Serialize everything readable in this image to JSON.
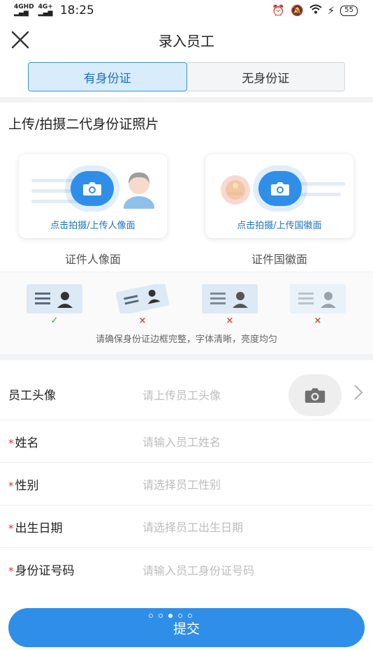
{
  "status_bar": {
    "signal_1": "4GHD",
    "signal_2": "4G+",
    "time": "18:25",
    "battery": "55"
  },
  "header": {
    "title": "录入员工"
  },
  "tabs": [
    {
      "label": "有身份证",
      "active": true
    },
    {
      "label": "无身份证",
      "active": false
    }
  ],
  "upload_section": {
    "title": "上传/拍摄二代身份证照片",
    "portrait_card": {
      "link": "点击拍摄/上传人像面",
      "caption": "证件人像面"
    },
    "emblem_card": {
      "link": "点击拍摄/上传国徽面",
      "caption": "证件国徽面"
    }
  },
  "tips": {
    "marks": [
      "✓",
      "×",
      "×",
      "×"
    ],
    "text": "请确保身份证边框完整，字体清晰，亮度均匀"
  },
  "form": {
    "avatar": {
      "label": "员工头像",
      "placeholder": "请上传员工头像"
    },
    "name": {
      "label": "姓名",
      "placeholder": "请输入员工姓名",
      "required": true
    },
    "gender": {
      "label": "性别",
      "placeholder": "请选择员工性别",
      "required": true
    },
    "birthdate": {
      "label": "出生日期",
      "placeholder": "请选择员工出生日期",
      "required": true
    },
    "id_number": {
      "label": "身份证号码",
      "placeholder": "请输入员工身份证号码",
      "required": true
    },
    "required_mark": "*"
  },
  "submit": {
    "label": "提交"
  },
  "colors": {
    "accent": "#2f8fe8",
    "tab_active_bg": "#d9ecfb",
    "required": "#e0352b",
    "ok": "#2fa84f",
    "bad": "#e04a3b"
  }
}
